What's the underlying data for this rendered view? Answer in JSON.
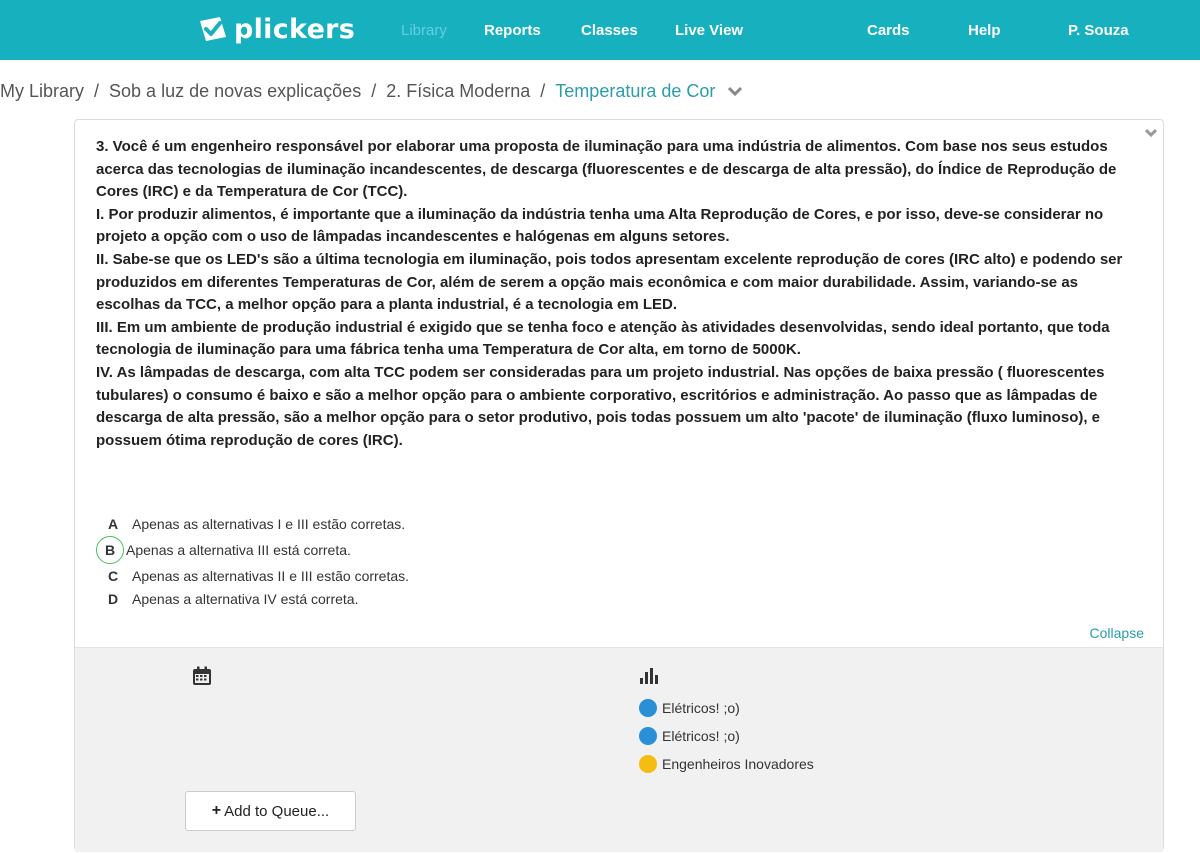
{
  "nav": {
    "logo_text": "plickers",
    "items": [
      {
        "label": "Library",
        "disabled": true
      },
      {
        "label": "Reports",
        "disabled": false
      },
      {
        "label": "Classes",
        "disabled": false
      },
      {
        "label": "Live View",
        "disabled": false
      },
      {
        "label": "Cards",
        "disabled": false
      },
      {
        "label": "Help",
        "disabled": false
      },
      {
        "label": "P. Souza",
        "disabled": false
      }
    ]
  },
  "breadcrumb": {
    "items": [
      "My Library",
      "Sob a luz de novas explicações",
      "2. Física Moderna",
      "Temperatura de Cor"
    ],
    "separator": "/"
  },
  "question": {
    "paragraphs": [
      "3. Você é um engenheiro responsável por elaborar uma proposta de iluminação para uma indústria de alimentos. Com base nos seus estudos acerca das tecnologias de iluminação incandescentes, de descarga (fluorescentes e de descarga de alta pressão), do Índice de Reprodução de Cores (IRC) e da Temperatura de Cor (TCC).",
      "I. Por produzir alimentos, é importante que a iluminação da indústria tenha uma Alta Reprodução de Cores, e por isso, deve-se considerar no projeto a opção com o uso de lâmpadas incandescentes e halógenas em alguns setores.",
      "II. Sabe-se que os LED's são a última tecnologia em iluminação, pois todos apresentam excelente reprodução de cores (IRC alto) e podendo ser produzidos em diferentes Temperaturas de Cor, além de serem a opção mais econômica e com maior durabilidade. Assim, variando-se as escolhas da TCC, a melhor opção para a planta industrial, é a tecnologia em LED.",
      "III. Em um ambiente de produção industrial é exigido que se tenha foco e atenção às atividades desenvolvidas, sendo ideal portanto, que toda tecnologia de iluminação para uma fábrica tenha uma Temperatura de Cor alta, em torno de 5000K.",
      "IV. As lâmpadas de descarga, com alta TCC podem ser consideradas para um projeto industrial. Nas opções de baixa pressão ( fluorescentes tubulares) o consumo é baixo e são a melhor opção para o ambiente corporativo, escritórios e administração. Ao passo que as lâmpadas de descarga de alta pressão, são a melhor opção para o setor produtivo, pois todas possuem um alto 'pacote' de iluminação (fluxo luminoso), e possuem ótima reprodução de cores (IRC)."
    ]
  },
  "answers": [
    {
      "letter": "A",
      "text": "Apenas as alternativas I e III estão corretas.",
      "correct": false
    },
    {
      "letter": "B",
      "text": "Apenas a alternativa III está correta.",
      "correct": true
    },
    {
      "letter": "C",
      "text": "Apenas as alternativas II e III estão corretas.",
      "correct": false
    },
    {
      "letter": "D",
      "text": "Apenas a alternativa IV está correta.",
      "correct": false
    }
  ],
  "collapse_label": "Collapse",
  "classes": [
    {
      "name": "Elétricos! ;o)",
      "color": "#2a8fd6"
    },
    {
      "name": "Elétricos! ;o)",
      "color": "#2a8fd6"
    },
    {
      "name": "Engenheiros Inovadores",
      "color": "#f5bd12"
    }
  ],
  "add_button_label": "Add to Queue...",
  "colors": {
    "brand": "#17b0bf",
    "link": "#2a9dab",
    "correct": "#44c35d"
  }
}
